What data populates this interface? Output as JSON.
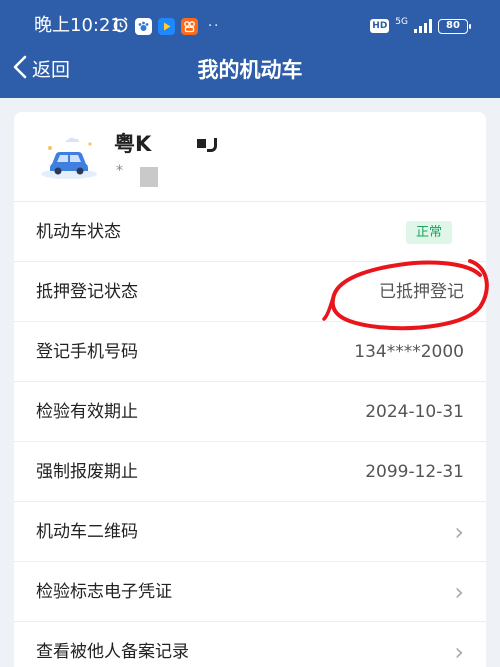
{
  "status_bar": {
    "time": "晚上10:21",
    "icons_left": [
      "alarm-icon",
      "paw-app-icon",
      "video-app-icon",
      "kuaishou-app-icon"
    ],
    "dots": "··",
    "hd": "HD",
    "network": "5G",
    "battery": "80"
  },
  "header": {
    "back_label": "返回",
    "title": "我的机动车"
  },
  "vehicle": {
    "plate": "粤K",
    "sub": "*"
  },
  "rows": [
    {
      "label": "机动车状态",
      "badge": "正常",
      "badge_color": "#1aa260"
    },
    {
      "label": "抵押登记状态",
      "value": "已抵押登记"
    },
    {
      "label": "登记手机号码",
      "value": "134****2000"
    },
    {
      "label": "检验有效期止",
      "value": "2024-10-31"
    },
    {
      "label": "强制报废期止",
      "value": "2099-12-31"
    },
    {
      "label": "机动车二维码",
      "chevron": "›"
    },
    {
      "label": "检验标志电子凭证",
      "chevron": "›"
    },
    {
      "label": "查看被他人备案记录",
      "chevron": "›"
    }
  ],
  "colors": {
    "header_bg": "#2e5ea9",
    "annotation": "#e8161b"
  }
}
